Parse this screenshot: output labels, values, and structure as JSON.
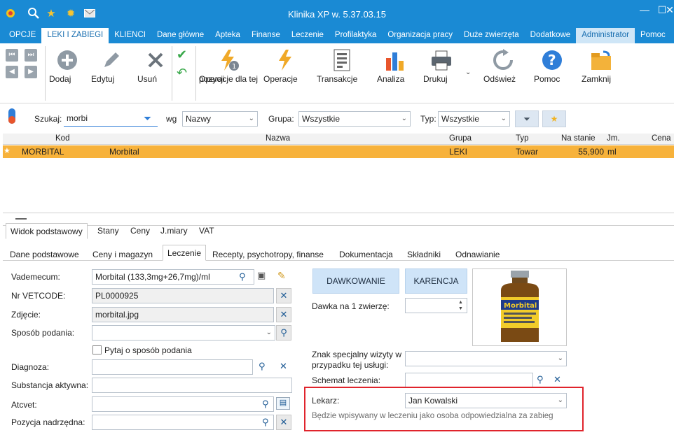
{
  "window": {
    "title": "Klinika XP w. 5.37.03.15"
  },
  "menubar": {
    "items": [
      "OPCJE",
      "LEKI I ZABIEGI",
      "KLIENCI",
      "Dane główne",
      "Apteka",
      "Finanse",
      "Leczenie",
      "Profilaktyka",
      "Organizacja pracy",
      "Duże zwierzęta",
      "Dodatkowe",
      "Administrator",
      "Pomoc"
    ]
  },
  "ribbon": {
    "add": "Dodaj",
    "edit": "Edytuj",
    "delete": "Usuń",
    "op_line1": "Operacje dla tej",
    "op_line2": "pozycji",
    "ops": "Operacje",
    "transactions": "Transakcje",
    "analysis": "Analiza",
    "print": "Drukuj",
    "refresh": "Odśwież",
    "help": "Pomoc",
    "close": "Zamknij"
  },
  "search": {
    "label": "Szukaj:",
    "value": "morbi",
    "by_label": "wg",
    "by_value": "Nazwy",
    "group_label": "Grupa:",
    "group_value": "Wszystkie",
    "type_label": "Typ:",
    "type_value": "Wszystkie"
  },
  "grid": {
    "columns": [
      "Kod",
      "Nazwa",
      "Grupa",
      "Typ",
      "Na stanie",
      "Jm.",
      "Cena"
    ],
    "rows": [
      {
        "kod": "MORBITAL",
        "nazwa": "Morbital",
        "grupa": "LEKI",
        "typ": "Towar",
        "na_stanie": "55,900",
        "jm": "ml"
      }
    ]
  },
  "view_tabs": [
    "Widok podstawowy",
    "Stany",
    "Ceny",
    "J.miary",
    "VAT"
  ],
  "detail_tabs": [
    "Dane podstawowe",
    "Ceny i magazyn",
    "Leczenie",
    "Recepty, psychotropy, finanse",
    "Dokumentacja",
    "Składniki",
    "Odnawianie"
  ],
  "form": {
    "vademecum_label": "Vademecum:",
    "vademecum_value": "Morbital (133,3mg+26,7mg)/ml",
    "vetcode_label": "Nr VETCODE:",
    "vetcode_value": "PL0000925",
    "photo_label": "Zdjęcie:",
    "photo_value": "morbital.jpg",
    "route_label": "Sposób podania:",
    "route_value": "",
    "ask_route": "Pytaj o sposób podania",
    "diagnosis_label": "Diagnoza:",
    "substance_label": "Substancja aktywna:",
    "atcvet_label": "Atcvet:",
    "parent_label": "Pozycja nadrzędna:",
    "dosing_btn": "DAWKOWANIE",
    "withdrawal_btn": "KARENCJA",
    "dose_label": "Dawka na 1 zwierzę:",
    "dose_value": "",
    "sign_label_1": "Znak specjalny wizyty w",
    "sign_label_2": "przypadku tej usługi:",
    "scheme_label": "Schemat leczenia:",
    "doctor_label": "Lekarz:",
    "doctor_value": "Jan Kowalski",
    "doctor_hint": "Będzie wpisywany w leczeniu jako osoba odpowiedzialna za zabieg",
    "product_label": "Morbital"
  }
}
